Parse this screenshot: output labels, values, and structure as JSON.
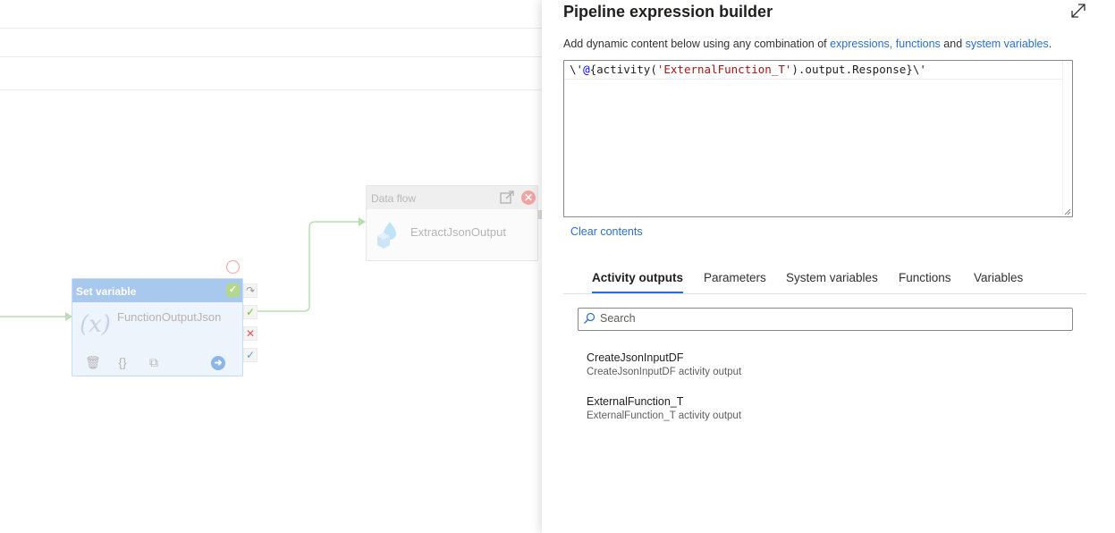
{
  "canvas": {
    "dataflow_activity": {
      "type_label": "Data flow",
      "name": "ExtractJsonOutput"
    },
    "setvar_activity": {
      "type_label": "Set variable",
      "name": "FunctionOutputJson",
      "fx_symbol": "(x)"
    }
  },
  "panel": {
    "title": "Pipeline expression builder",
    "description": {
      "prefix": "Add dynamic content below using any combination of ",
      "link1": "expressions,",
      "link2": "functions",
      "and_text": " and ",
      "link3": "system variables",
      "suffix": "."
    },
    "expression": {
      "part1": "\\'",
      "at": "@",
      "part2": "{activity(",
      "string": "'ExternalFunction_T'",
      "part3": ").output.Response}\\'"
    },
    "clear_label": "Clear contents",
    "tabs": [
      {
        "label": "Activity outputs",
        "active": true
      },
      {
        "label": "Parameters"
      },
      {
        "label": "System variables"
      },
      {
        "label": "Functions"
      },
      {
        "label": "Variables"
      }
    ],
    "search": {
      "placeholder": "Search",
      "value": ""
    },
    "outputs": [
      {
        "name": "CreateJsonInputDF",
        "description": "CreateJsonInputDF activity output"
      },
      {
        "name": "ExternalFunction_T",
        "description": "ExternalFunction_T activity output"
      }
    ]
  },
  "colors": {
    "accent": "#2a6fc9",
    "success": "#7bbf3f",
    "error": "#e05757"
  }
}
